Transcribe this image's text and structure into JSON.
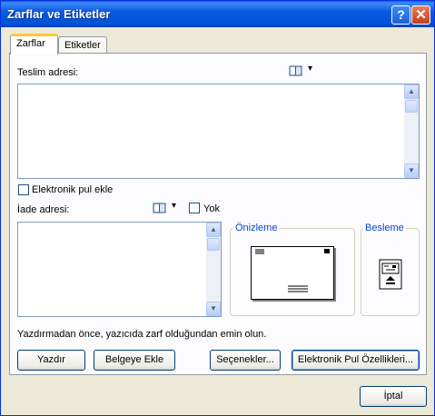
{
  "window": {
    "title": "Zarflar ve Etiketler",
    "help_glyph": "?",
    "close_glyph": "✕"
  },
  "tabs": [
    {
      "label": "Zarflar",
      "active": true
    },
    {
      "label": "Etiketler",
      "active": false
    }
  ],
  "delivery": {
    "label": "Teslim adresi:",
    "value": ""
  },
  "electronic_postage": {
    "label": "Elektronik pul ekle",
    "checked": false
  },
  "return_address": {
    "label": "İade adresi:",
    "value": "",
    "omit_label": "Yok",
    "omit_checked": false
  },
  "preview": {
    "label": "Önizleme"
  },
  "feed": {
    "label": "Besleme"
  },
  "note": "Yazdırmadan önce, yazıcıda zarf olduğundan emin olun.",
  "buttons": {
    "print": "Yazdır",
    "add_to_document": "Belgeye Ekle",
    "options": "Seçenekler...",
    "e_postage_properties": "Elektronik Pul Özellikleri...",
    "cancel": "İptal"
  },
  "icons": {
    "address_book": "address-book-icon",
    "dropdown": "▾"
  }
}
